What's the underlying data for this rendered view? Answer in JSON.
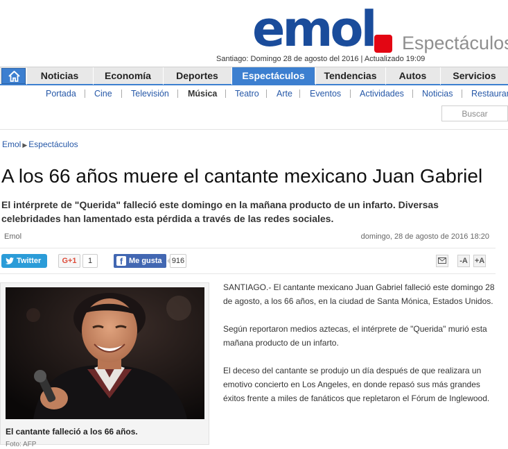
{
  "header": {
    "logo": "emol",
    "section": "Espectáculos",
    "dateline": "Santiago: Domingo 28 de agosto del 2016 | Actualizado 19:09"
  },
  "colors": {
    "brand_blue": "#1a4c9b",
    "brand_red": "#e30613",
    "nav_active": "#3c7fd0",
    "link": "#2557a7"
  },
  "main_nav": {
    "home_icon": "home-icon",
    "items": [
      {
        "label": "Noticias"
      },
      {
        "label": "Economía"
      },
      {
        "label": "Deportes"
      },
      {
        "label": "Espectáculos"
      },
      {
        "label": "Tendencias"
      },
      {
        "label": "Autos"
      },
      {
        "label": "Servicios"
      }
    ],
    "active": "Espectáculos"
  },
  "sub_nav": {
    "items": [
      {
        "label": "Portada"
      },
      {
        "label": "Cine"
      },
      {
        "label": "Televisión"
      },
      {
        "label": "Música"
      },
      {
        "label": "Teatro"
      },
      {
        "label": "Arte"
      },
      {
        "label": "Eventos"
      },
      {
        "label": "Actividades"
      },
      {
        "label": "Noticias"
      },
      {
        "label": "Restaurant"
      }
    ],
    "active": "Música"
  },
  "search": {
    "placeholder": "Buscar"
  },
  "breadcrumb": {
    "home": "Emol",
    "section": "Espectáculos"
  },
  "article": {
    "title": "A los 66 años muere el cantante mexicano Juan Gabriel",
    "lead": "El intérprete de \"Querida\" falleció este domingo en la mañana producto de un infarto. Diversas celebridades han lamentado esta pérdida a través de las redes sociales.",
    "author": "Emol",
    "date": "domingo, 28 de agosto de 2016 18:20",
    "paragraphs": [
      "SANTIAGO.- El cantante mexicano Juan Gabriel falleció este domingo 28 de agosto, a los 66 años, en la ciudad de Santa Mónica, Estados Unidos.",
      "Según reportaron medios aztecas, el intérprete de \"Querida\" murió esta mañana producto de un infarto.",
      "El deceso del cantante se produjo un día después de que realizara un emotivo concierto en Los Angeles, en donde repasó sus más grandes éxitos frente a miles de fanáticos que repletaron el Fórum de Inglewood."
    ]
  },
  "social": {
    "twitter_label": "Twitter",
    "gplus_label": "G+1",
    "gplus_count": "1",
    "facebook_label": "Me gusta",
    "facebook_count": "916",
    "tools": {
      "email_icon": "email-icon",
      "text_smaller": "-A",
      "text_larger": "+A"
    }
  },
  "photo": {
    "caption": "El cantante falleció a los 66 años.",
    "credit": "Foto: AFP"
  }
}
